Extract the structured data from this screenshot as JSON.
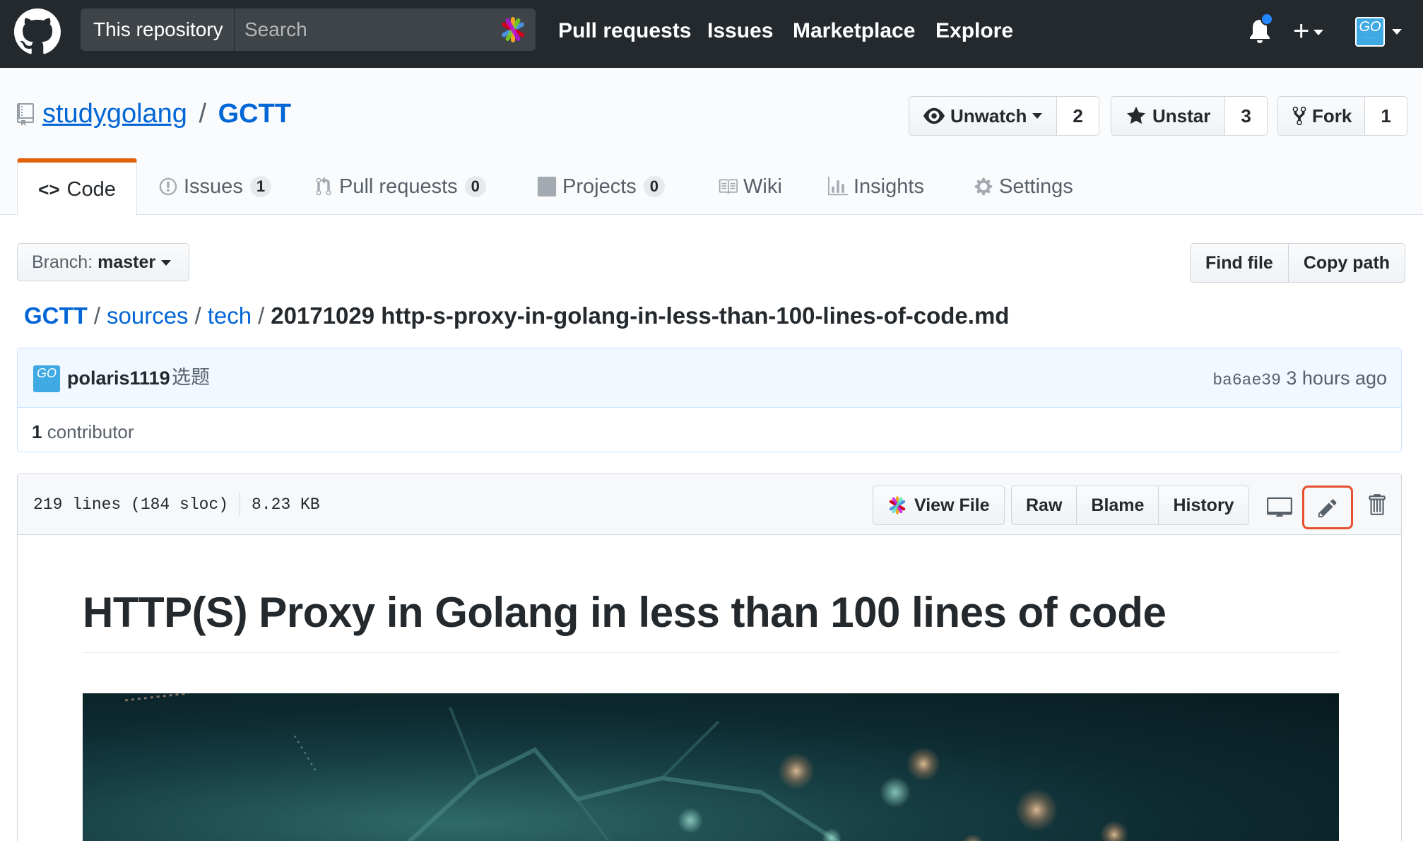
{
  "header": {
    "scope_label": "This repository",
    "search_placeholder": "Search",
    "nav": [
      "Pull requests",
      "Issues",
      "Marketplace",
      "Explore"
    ],
    "plus_label": "+",
    "avatar_text": "GO"
  },
  "repo": {
    "owner": "studygolang",
    "separator": "/",
    "name": "GCTT",
    "watch": {
      "label": "Unwatch",
      "count": "2"
    },
    "star": {
      "label": "Unstar",
      "count": "3"
    },
    "fork": {
      "label": "Fork",
      "count": "1"
    }
  },
  "tabs": [
    {
      "label": "Code"
    },
    {
      "label": "Issues",
      "count": "1"
    },
    {
      "label": "Pull requests",
      "count": "0"
    },
    {
      "label": "Projects",
      "count": "0"
    },
    {
      "label": "Wiki"
    },
    {
      "label": "Insights"
    },
    {
      "label": "Settings"
    }
  ],
  "file_nav": {
    "branch_prefix": "Branch:",
    "branch": "master",
    "find_file": "Find file",
    "copy_path": "Copy path"
  },
  "breadcrumb": {
    "root": "GCTT",
    "parts": [
      "sources",
      "tech"
    ],
    "file": "20171029 http-s-proxy-in-golang-in-less-than-100-lines-of-code.md"
  },
  "commit": {
    "avatar_text": "GO",
    "author": "polaris1119",
    "message": "选题",
    "sha": "ba6ae39",
    "time": "3 hours ago",
    "contributors_count": "1",
    "contributors_label": "contributor"
  },
  "file": {
    "lines": "219 lines (184 sloc)",
    "size": "8.23 KB",
    "view_file": "View File",
    "raw": "Raw",
    "blame": "Blame",
    "history": "History",
    "heading": "HTTP(S) Proxy in Golang in less than 100 lines of code"
  },
  "colors": {
    "header_bg": "#24292e",
    "link": "#0366d6",
    "tab_accent": "#e36209",
    "highlight_box": "#e84f2e",
    "commit_bg": "#f1f8ff"
  }
}
